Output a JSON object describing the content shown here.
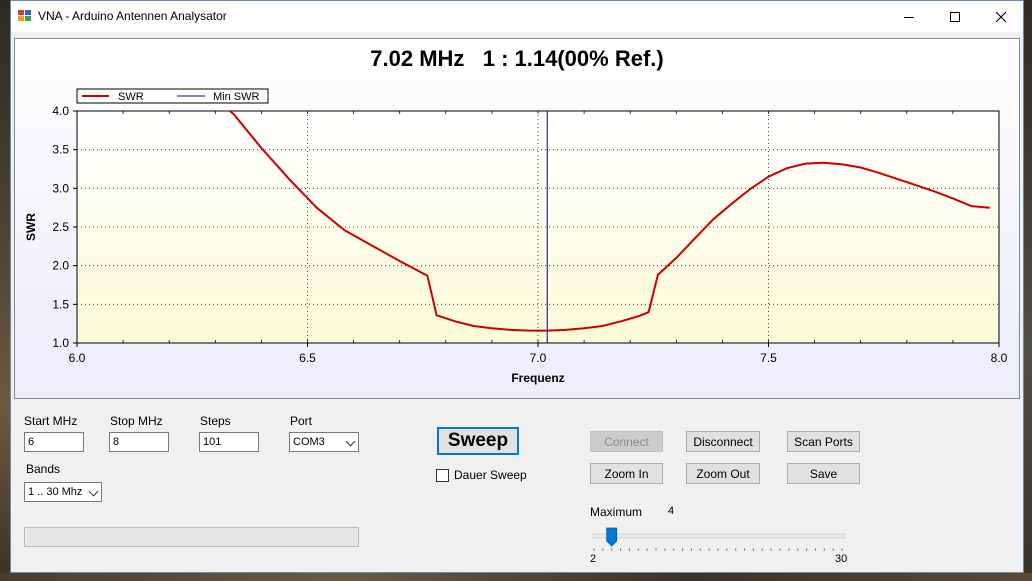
{
  "window": {
    "title": "VNA - Arduino Antennen Analysator",
    "controls": {
      "minimize_icon": "minimize-icon",
      "maximize_icon": "maximize-icon",
      "close_icon": "close-icon"
    }
  },
  "chart_title": "7.02 MHz   1 : 1.14(00% Ref.)",
  "chart_data": {
    "type": "line",
    "title": "7.02 MHz   1 : 1.14(00% Ref.)",
    "xlabel": "Frequenz",
    "ylabel": "SWR",
    "xlim": [
      6.0,
      8.0
    ],
    "ylim": [
      1.0,
      4.0
    ],
    "x_ticks": [
      "6.0",
      "6.5",
      "7.0",
      "7.5",
      "8.0"
    ],
    "y_ticks": [
      "1.0",
      "1.5",
      "2.0",
      "2.5",
      "3.0",
      "3.5",
      "4.0"
    ],
    "grid": "dotted",
    "legend_position": "top-left",
    "marker_x": 7.02,
    "colors": {
      "swr": "#cc0000",
      "min_swr": "#000080"
    },
    "series": [
      {
        "name": "SWR",
        "x": [
          6.2,
          6.34,
          6.4,
          6.46,
          6.52,
          6.58,
          6.64,
          6.7,
          6.76,
          6.78,
          6.82,
          6.86,
          6.9,
          6.94,
          6.98,
          7.02,
          7.06,
          7.1,
          7.14,
          7.18,
          7.22,
          7.24,
          7.26,
          7.3,
          7.34,
          7.38,
          7.42,
          7.46,
          7.5,
          7.54,
          7.58,
          7.62,
          7.66,
          7.7,
          7.74,
          7.78,
          7.82,
          7.86,
          7.9,
          7.94,
          7.98
        ],
        "y": [
          4.6,
          3.96,
          3.52,
          3.12,
          2.75,
          2.46,
          2.26,
          2.06,
          1.87,
          1.36,
          1.28,
          1.22,
          1.19,
          1.17,
          1.16,
          1.16,
          1.17,
          1.19,
          1.22,
          1.28,
          1.35,
          1.4,
          1.88,
          2.1,
          2.35,
          2.6,
          2.8,
          2.99,
          3.15,
          3.26,
          3.32,
          3.33,
          3.31,
          3.27,
          3.2,
          3.12,
          3.04,
          2.96,
          2.87,
          2.77,
          2.75
        ]
      },
      {
        "name": "Min SWR",
        "x": [
          7.02,
          7.02
        ],
        "y": [
          1.0,
          4.0
        ]
      }
    ]
  },
  "controls": {
    "start_label": "Start MHz",
    "start_value": "6",
    "stop_label": "Stop MHz",
    "stop_value": "8",
    "steps_label": "Steps",
    "steps_value": "101",
    "port_label": "Port",
    "port_value": "COM3",
    "bands_label": "Bands",
    "bands_value": "1 .. 30 Mhz",
    "sweep_label": "Sweep",
    "dauer_sweep_label": "Dauer Sweep",
    "dauer_sweep_checked": false,
    "connect_label": "Connect",
    "disconnect_label": "Disconnect",
    "scan_ports_label": "Scan Ports",
    "zoom_in_label": "Zoom In",
    "zoom_out_label": "Zoom Out",
    "save_label": "Save",
    "maximum_label": "Maximum",
    "maximum_value": "4",
    "slider_min": "2",
    "slider_max": "30",
    "progress": 0
  }
}
